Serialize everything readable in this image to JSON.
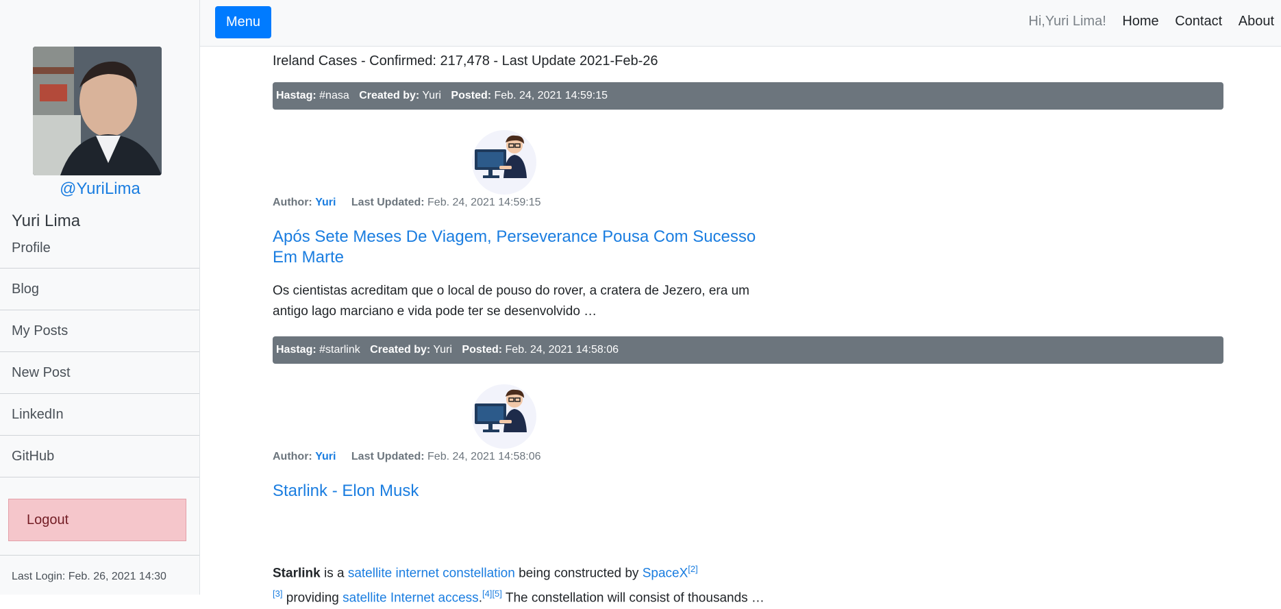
{
  "sidebar": {
    "handle": "@YuriLima",
    "name": "Yuri Lima",
    "items": [
      {
        "label": "Profile"
      },
      {
        "label": "Blog"
      },
      {
        "label": "My Posts"
      },
      {
        "label": "New Post"
      },
      {
        "label": "LinkedIn"
      },
      {
        "label": "GitHub"
      }
    ],
    "logout_label": "Logout",
    "last_login": "Last Login: Feb. 26, 2021 14:30"
  },
  "navbar": {
    "menu_label": "Menu",
    "greeting": "Hi,Yuri Lima!",
    "links": [
      "Home",
      "Contact",
      "About"
    ]
  },
  "covid_line": "Ireland Cases - Confirmed: 217,478 - Last Update 2021-Feb-26",
  "posts": [
    {
      "hashtag_label": "Hastag:",
      "hashtag": "#nasa",
      "created_label": "Created by:",
      "created_by": "Yuri",
      "posted_label": "Posted:",
      "posted": "Feb. 24, 2021 14:59:15",
      "author_label": "Author:",
      "author": "Yuri",
      "updated_label": "Last Updated:",
      "updated": "Feb. 24, 2021 14:59:15",
      "title": "Após Sete Meses De Viagem, Perseverance Pousa Com Sucesso Em Marte",
      "body": "Os cientistas acreditam que o local de pouso do rover, a cratera de Jezero, era um antigo lago marciano e vida pode ter se desenvolvido …"
    },
    {
      "hashtag_label": "Hastag:",
      "hashtag": "#starlink",
      "created_label": "Created by:",
      "created_by": "Yuri",
      "posted_label": "Posted:",
      "posted": "Feb. 24, 2021 14:58:06",
      "author_label": "Author:",
      "author": "Yuri",
      "updated_label": "Last Updated:",
      "updated": "Feb. 24, 2021 14:58:06",
      "title": "Starlink - Elon Musk",
      "body_parts": {
        "bold": "Starlink",
        "t1": " is a ",
        "link1": "satellite internet constellation",
        "t2": " being constructed by ",
        "link2": "SpaceX",
        "ref1": "[2]",
        "ref2": "[3]",
        "t3": " providing ",
        "link3": "satellite Internet access",
        "t4": ".",
        "ref3": "[4]",
        "ref4": "[5]",
        "t5": " The constellation will consist of thousands …"
      }
    }
  ],
  "colors": {
    "primary": "#007bff",
    "link": "#1a7de0",
    "meta_bar": "#6c757d",
    "logout_bg": "#f5c6cb"
  },
  "icons": {
    "post_image": "developer-at-computer-illustration",
    "avatar": "profile-photo"
  }
}
